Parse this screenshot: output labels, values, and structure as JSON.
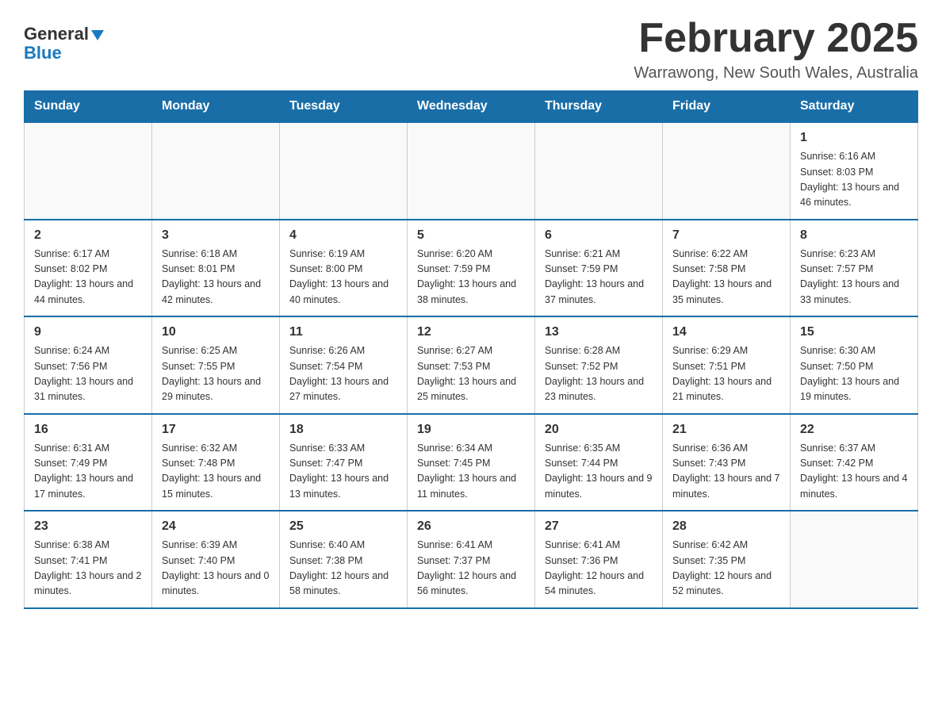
{
  "header": {
    "logo_general": "General",
    "logo_blue": "Blue",
    "title": "February 2025",
    "subtitle": "Warrawong, New South Wales, Australia"
  },
  "days_of_week": [
    "Sunday",
    "Monday",
    "Tuesday",
    "Wednesday",
    "Thursday",
    "Friday",
    "Saturday"
  ],
  "weeks": [
    [
      {
        "day": "",
        "info": ""
      },
      {
        "day": "",
        "info": ""
      },
      {
        "day": "",
        "info": ""
      },
      {
        "day": "",
        "info": ""
      },
      {
        "day": "",
        "info": ""
      },
      {
        "day": "",
        "info": ""
      },
      {
        "day": "1",
        "info": "Sunrise: 6:16 AM\nSunset: 8:03 PM\nDaylight: 13 hours and 46 minutes."
      }
    ],
    [
      {
        "day": "2",
        "info": "Sunrise: 6:17 AM\nSunset: 8:02 PM\nDaylight: 13 hours and 44 minutes."
      },
      {
        "day": "3",
        "info": "Sunrise: 6:18 AM\nSunset: 8:01 PM\nDaylight: 13 hours and 42 minutes."
      },
      {
        "day": "4",
        "info": "Sunrise: 6:19 AM\nSunset: 8:00 PM\nDaylight: 13 hours and 40 minutes."
      },
      {
        "day": "5",
        "info": "Sunrise: 6:20 AM\nSunset: 7:59 PM\nDaylight: 13 hours and 38 minutes."
      },
      {
        "day": "6",
        "info": "Sunrise: 6:21 AM\nSunset: 7:59 PM\nDaylight: 13 hours and 37 minutes."
      },
      {
        "day": "7",
        "info": "Sunrise: 6:22 AM\nSunset: 7:58 PM\nDaylight: 13 hours and 35 minutes."
      },
      {
        "day": "8",
        "info": "Sunrise: 6:23 AM\nSunset: 7:57 PM\nDaylight: 13 hours and 33 minutes."
      }
    ],
    [
      {
        "day": "9",
        "info": "Sunrise: 6:24 AM\nSunset: 7:56 PM\nDaylight: 13 hours and 31 minutes."
      },
      {
        "day": "10",
        "info": "Sunrise: 6:25 AM\nSunset: 7:55 PM\nDaylight: 13 hours and 29 minutes."
      },
      {
        "day": "11",
        "info": "Sunrise: 6:26 AM\nSunset: 7:54 PM\nDaylight: 13 hours and 27 minutes."
      },
      {
        "day": "12",
        "info": "Sunrise: 6:27 AM\nSunset: 7:53 PM\nDaylight: 13 hours and 25 minutes."
      },
      {
        "day": "13",
        "info": "Sunrise: 6:28 AM\nSunset: 7:52 PM\nDaylight: 13 hours and 23 minutes."
      },
      {
        "day": "14",
        "info": "Sunrise: 6:29 AM\nSunset: 7:51 PM\nDaylight: 13 hours and 21 minutes."
      },
      {
        "day": "15",
        "info": "Sunrise: 6:30 AM\nSunset: 7:50 PM\nDaylight: 13 hours and 19 minutes."
      }
    ],
    [
      {
        "day": "16",
        "info": "Sunrise: 6:31 AM\nSunset: 7:49 PM\nDaylight: 13 hours and 17 minutes."
      },
      {
        "day": "17",
        "info": "Sunrise: 6:32 AM\nSunset: 7:48 PM\nDaylight: 13 hours and 15 minutes."
      },
      {
        "day": "18",
        "info": "Sunrise: 6:33 AM\nSunset: 7:47 PM\nDaylight: 13 hours and 13 minutes."
      },
      {
        "day": "19",
        "info": "Sunrise: 6:34 AM\nSunset: 7:45 PM\nDaylight: 13 hours and 11 minutes."
      },
      {
        "day": "20",
        "info": "Sunrise: 6:35 AM\nSunset: 7:44 PM\nDaylight: 13 hours and 9 minutes."
      },
      {
        "day": "21",
        "info": "Sunrise: 6:36 AM\nSunset: 7:43 PM\nDaylight: 13 hours and 7 minutes."
      },
      {
        "day": "22",
        "info": "Sunrise: 6:37 AM\nSunset: 7:42 PM\nDaylight: 13 hours and 4 minutes."
      }
    ],
    [
      {
        "day": "23",
        "info": "Sunrise: 6:38 AM\nSunset: 7:41 PM\nDaylight: 13 hours and 2 minutes."
      },
      {
        "day": "24",
        "info": "Sunrise: 6:39 AM\nSunset: 7:40 PM\nDaylight: 13 hours and 0 minutes."
      },
      {
        "day": "25",
        "info": "Sunrise: 6:40 AM\nSunset: 7:38 PM\nDaylight: 12 hours and 58 minutes."
      },
      {
        "day": "26",
        "info": "Sunrise: 6:41 AM\nSunset: 7:37 PM\nDaylight: 12 hours and 56 minutes."
      },
      {
        "day": "27",
        "info": "Sunrise: 6:41 AM\nSunset: 7:36 PM\nDaylight: 12 hours and 54 minutes."
      },
      {
        "day": "28",
        "info": "Sunrise: 6:42 AM\nSunset: 7:35 PM\nDaylight: 12 hours and 52 minutes."
      },
      {
        "day": "",
        "info": ""
      }
    ]
  ]
}
